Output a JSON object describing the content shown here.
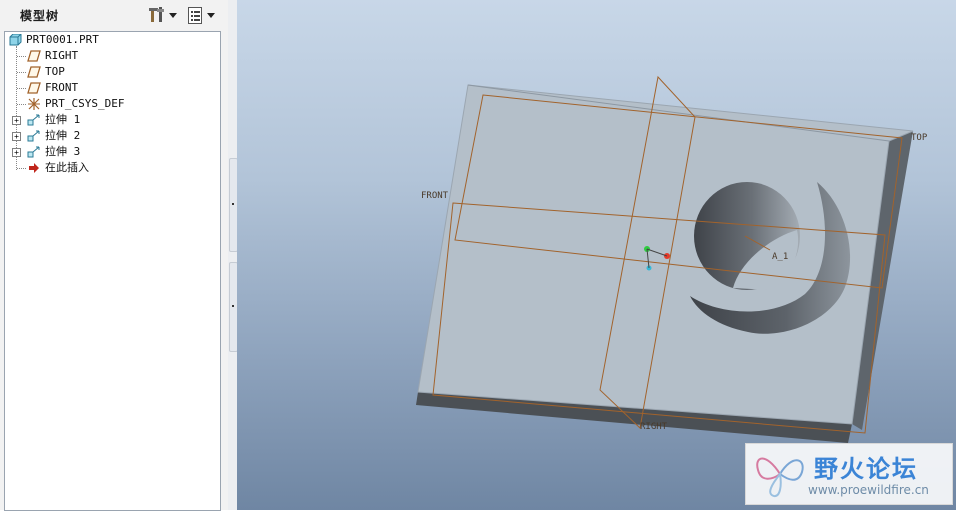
{
  "model_tree": {
    "title": "模型树",
    "items": [
      {
        "label": "PRT0001.PRT",
        "icon": "part-icon",
        "expandable": false
      },
      {
        "label": "RIGHT",
        "icon": "datum-plane-icon",
        "expandable": false
      },
      {
        "label": "TOP",
        "icon": "datum-plane-icon",
        "expandable": false
      },
      {
        "label": "FRONT",
        "icon": "datum-plane-icon",
        "expandable": false
      },
      {
        "label": "PRT_CSYS_DEF",
        "icon": "coordinate-system-icon",
        "expandable": false
      },
      {
        "label": "拉伸 1",
        "icon": "extrude-icon",
        "expandable": true
      },
      {
        "label": "拉伸 2",
        "icon": "extrude-icon",
        "expandable": true
      },
      {
        "label": "拉伸 3",
        "icon": "extrude-icon",
        "expandable": true
      },
      {
        "label": "在此插入",
        "icon": "insert-here-arrow-icon",
        "expandable": false
      }
    ],
    "toolbar": {
      "settings_icon": "tree-settings-icon",
      "columns_icon": "tree-columns-icon"
    }
  },
  "viewport": {
    "datum_labels": {
      "top": "TOP",
      "front": "FRONT",
      "right": "RIGHT",
      "axis": "A_1"
    },
    "colors": {
      "datum_plane": "#a2632c",
      "part_face": "#b4bfc9",
      "csys_x": "#e53a2a",
      "csys_y": "#2ecc40",
      "csys_z": "#35b8d6"
    }
  },
  "watermark": {
    "title": "野火论坛",
    "url": "www.proewildfire.cn"
  }
}
